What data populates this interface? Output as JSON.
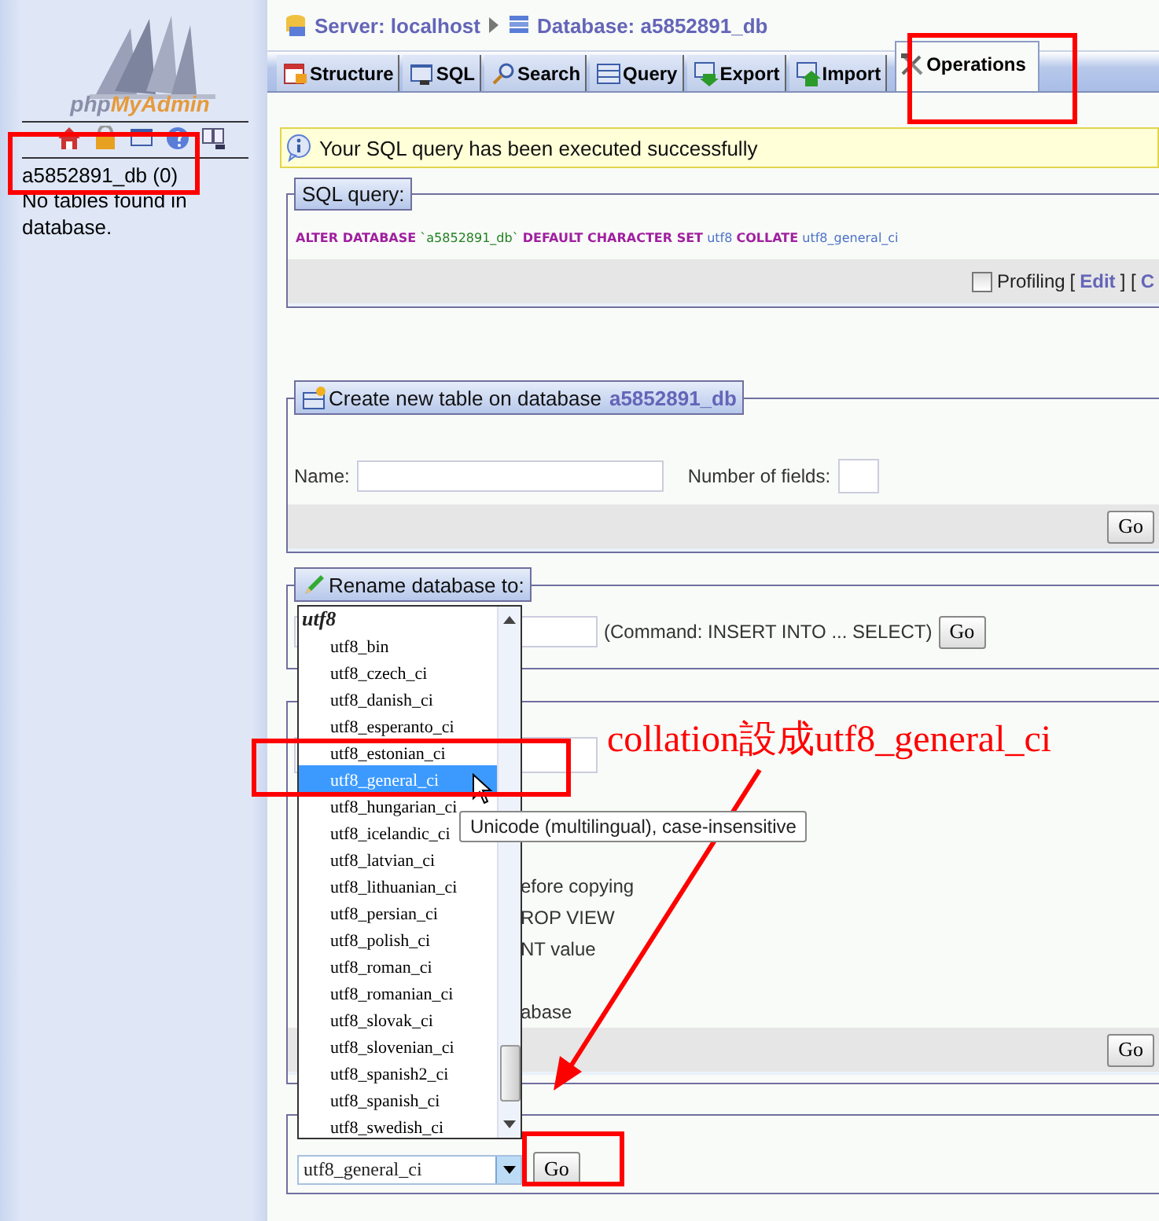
{
  "sidebar": {
    "logo_text": [
      "php",
      "MyAdmin"
    ],
    "database": "a5852891_db (0)",
    "note": "No tables found in database."
  },
  "breadcrumb": {
    "server": "Server: localhost",
    "database": "Database: a5852891_db"
  },
  "tabs": [
    {
      "label": "Structure",
      "kind": "structure",
      "selected": false
    },
    {
      "label": "SQL",
      "kind": "sql",
      "selected": false
    },
    {
      "label": "Search",
      "kind": "search",
      "selected": false
    },
    {
      "label": "Query",
      "kind": "query",
      "selected": false
    },
    {
      "label": "Export",
      "kind": "export",
      "selected": false
    },
    {
      "label": "Import",
      "kind": "import",
      "selected": false
    },
    {
      "label": "Operations",
      "kind": "operations",
      "selected": true
    }
  ],
  "message": "Your SQL query has been executed successfully",
  "sql_query": {
    "legend": "SQL query:",
    "tokens": [
      {
        "text": "ALTER DATABASE",
        "kind": "keyword"
      },
      {
        "text": "`a5852891_db`",
        "kind": "name"
      },
      {
        "text": "DEFAULT CHARACTER SET",
        "kind": "keyword"
      },
      {
        "text": "utf8",
        "kind": "value"
      },
      {
        "text": "COLLATE",
        "kind": "keyword"
      },
      {
        "text": "utf8_general_ci",
        "kind": "value"
      }
    ],
    "profiling": {
      "label": "Profiling",
      "checked": false
    },
    "tail": [
      {
        "text": "[",
        "kind": "plain"
      },
      {
        "text": "Edit",
        "kind": "link"
      },
      {
        "text": "] [",
        "kind": "plain"
      },
      {
        "text": "C",
        "kind": "link"
      }
    ]
  },
  "create_table": {
    "legend": "Create new table on database",
    "legend_db": "a5852891_db",
    "name_label": "Name:",
    "fields_label": "Number of fields:",
    "go": "Go"
  },
  "rename": {
    "legend": "Rename database to:",
    "command": "(Command: INSERT INTO ... SELECT)",
    "go": "Go"
  },
  "copy": {
    "lines": [
      "efore copying",
      "ROP VIEW",
      "NT value",
      "abase"
    ],
    "go": "Go"
  },
  "collation": {
    "value": "utf8_general_ci",
    "go": "Go"
  },
  "dropdown": {
    "group": "utf8",
    "options": [
      {
        "text": "utf8_bin",
        "selected": false
      },
      {
        "text": "utf8_czech_ci",
        "selected": false
      },
      {
        "text": "utf8_danish_ci",
        "selected": false
      },
      {
        "text": "utf8_esperanto_ci",
        "selected": false
      },
      {
        "text": "utf8_estonian_ci",
        "selected": false
      },
      {
        "text": "utf8_general_ci",
        "selected": true
      },
      {
        "text": "utf8_hungarian_ci",
        "selected": false
      },
      {
        "text": "utf8_icelandic_ci",
        "selected": false
      },
      {
        "text": "utf8_latvian_ci",
        "selected": false
      },
      {
        "text": "utf8_lithuanian_ci",
        "selected": false
      },
      {
        "text": "utf8_persian_ci",
        "selected": false
      },
      {
        "text": "utf8_polish_ci",
        "selected": false
      },
      {
        "text": "utf8_roman_ci",
        "selected": false
      },
      {
        "text": "utf8_romanian_ci",
        "selected": false
      },
      {
        "text": "utf8_slovak_ci",
        "selected": false
      },
      {
        "text": "utf8_slovenian_ci",
        "selected": false
      },
      {
        "text": "utf8_spanish2_ci",
        "selected": false
      },
      {
        "text": "utf8_spanish_ci",
        "selected": false
      },
      {
        "text": "utf8_swedish_ci",
        "selected": false
      }
    ]
  },
  "tooltip": "Unicode (multilingual), case-insensitive",
  "annotation": "collation設成utf8_general_ci"
}
